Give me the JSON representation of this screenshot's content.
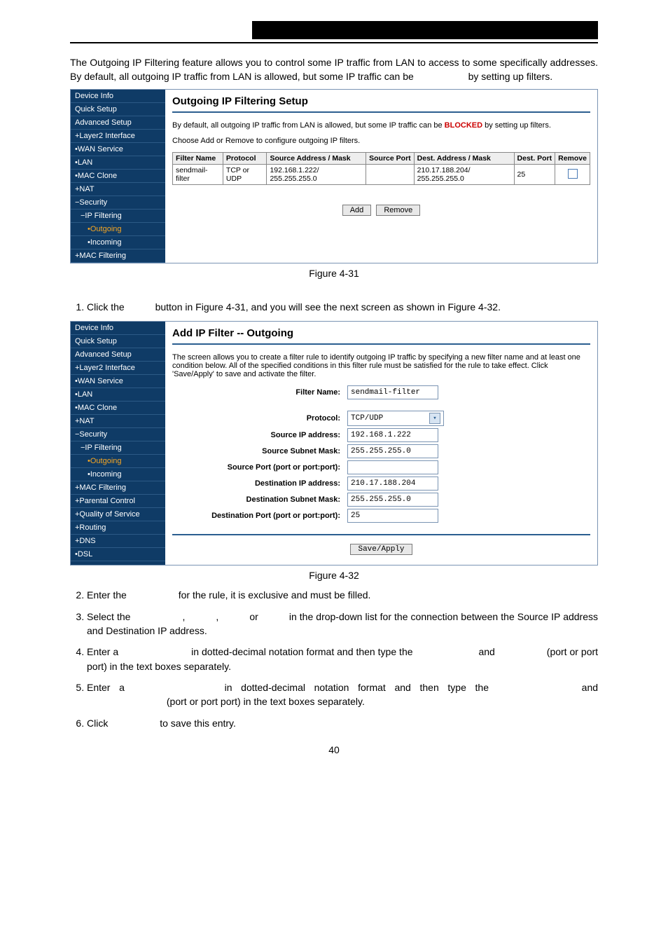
{
  "intro": "The Outgoing IP Filtering feature allows you to control some IP traffic from LAN to access to some specifically addresses. By default, all outgoing IP traffic from LAN is allowed, but some IP traffic can be",
  "intro_tail": "by setting up filters.",
  "fig31_caption": "Figure 4-31",
  "fig32_caption": "Figure 4-32",
  "page_number": "40",
  "shot1": {
    "title": "Outgoing IP Filtering Setup",
    "note_a": "By default, all outgoing IP traffic from LAN is allowed, but some IP traffic can be ",
    "note_blocked": "BLOCKED",
    "note_b": " by setting up filters.",
    "choose": "Choose Add or Remove to configure outgoing IP filters.",
    "headers": {
      "filter_name": "Filter Name",
      "protocol": "Protocol",
      "src": "Source Address / Mask",
      "sport": "Source Port",
      "dst": "Dest. Address / Mask",
      "dport": "Dest. Port",
      "remove": "Remove"
    },
    "row": {
      "filter_name": "sendmail-filter",
      "protocol": "TCP or UDP",
      "src": "192.168.1.222/ 255.255.255.0",
      "sport": "",
      "dst": "210.17.188.204/ 255.255.255.0",
      "dport": "25"
    },
    "btn_add": "Add",
    "btn_remove": "Remove",
    "sidebar": [
      {
        "label": "Device Info"
      },
      {
        "label": "Quick Setup"
      },
      {
        "label": "Advanced Setup"
      },
      {
        "label": "+Layer2 Interface"
      },
      {
        "label": "•WAN Service"
      },
      {
        "label": "•LAN"
      },
      {
        "label": "•MAC Clone"
      },
      {
        "label": "+NAT"
      },
      {
        "label": "−Security"
      },
      {
        "label": "−IP Filtering",
        "sub": 1
      },
      {
        "label": "•Outgoing",
        "sub": 2,
        "active": true
      },
      {
        "label": "•Incoming",
        "sub": 2
      },
      {
        "label": "+MAC Filtering"
      }
    ]
  },
  "shot2": {
    "title": "Add IP Filter -- Outgoing",
    "desc": "The screen allows you to create a filter rule to identify outgoing IP traffic by specifying a new filter name and at least one condition below. All of the specified conditions in this filter rule must be satisfied for the rule to take effect. Click 'Save/Apply' to save and activate the filter.",
    "fields": {
      "filter_name_label": "Filter Name:",
      "filter_name": "sendmail-filter",
      "protocol_label": "Protocol:",
      "protocol": "TCP/UDP",
      "src_ip_label": "Source IP address:",
      "src_ip": "192.168.1.222",
      "src_mask_label": "Source Subnet Mask:",
      "src_mask": "255.255.255.0",
      "src_port_label": "Source Port (port or port:port):",
      "src_port": "",
      "dst_ip_label": "Destination IP address:",
      "dst_ip": "210.17.188.204",
      "dst_mask_label": "Destination Subnet Mask:",
      "dst_mask": "255.255.255.0",
      "dst_port_label": "Destination Port (port or port:port):",
      "dst_port": "25"
    },
    "btn_save": "Save/Apply",
    "sidebar": [
      {
        "label": "Device Info"
      },
      {
        "label": "Quick Setup"
      },
      {
        "label": "Advanced Setup"
      },
      {
        "label": "+Layer2 Interface"
      },
      {
        "label": "•WAN Service"
      },
      {
        "label": "•LAN"
      },
      {
        "label": "•MAC Clone"
      },
      {
        "label": "+NAT"
      },
      {
        "label": "−Security"
      },
      {
        "label": "−IP Filtering",
        "sub": 1
      },
      {
        "label": "•Outgoing",
        "sub": 2,
        "active": true
      },
      {
        "label": "•Incoming",
        "sub": 2
      },
      {
        "label": "+MAC Filtering"
      },
      {
        "label": "+Parental Control"
      },
      {
        "label": "+Quality of Service"
      },
      {
        "label": "+Routing"
      },
      {
        "label": "+DNS"
      },
      {
        "label": "•DSL"
      }
    ]
  },
  "steps": {
    "s1a": "Click the",
    "s1b": "button in Figure 4-31, and you will see the next screen as shown in Figure 4-32.",
    "s2a": "Enter the",
    "s2b": "for the rule, it is exclusive and must be filled.",
    "s3a": "Select the",
    "s3b": ",",
    "s3c": ",",
    "s3d": "or",
    "s3e": "in the drop-down list for the connection between the Source IP address and Destination IP address.",
    "s4a": "Enter a",
    "s4b": "in dotted-decimal notation format and then type the",
    "s4c": "and",
    "s4d": "(port or port  port) in the text boxes separately.",
    "s5a": "Enter a",
    "s5b": "in dotted-decimal notation format and then type the",
    "s5c": "and",
    "s5d": "(port or port  port) in the text boxes separately.",
    "s6a": "Click",
    "s6b": "to save this entry."
  }
}
